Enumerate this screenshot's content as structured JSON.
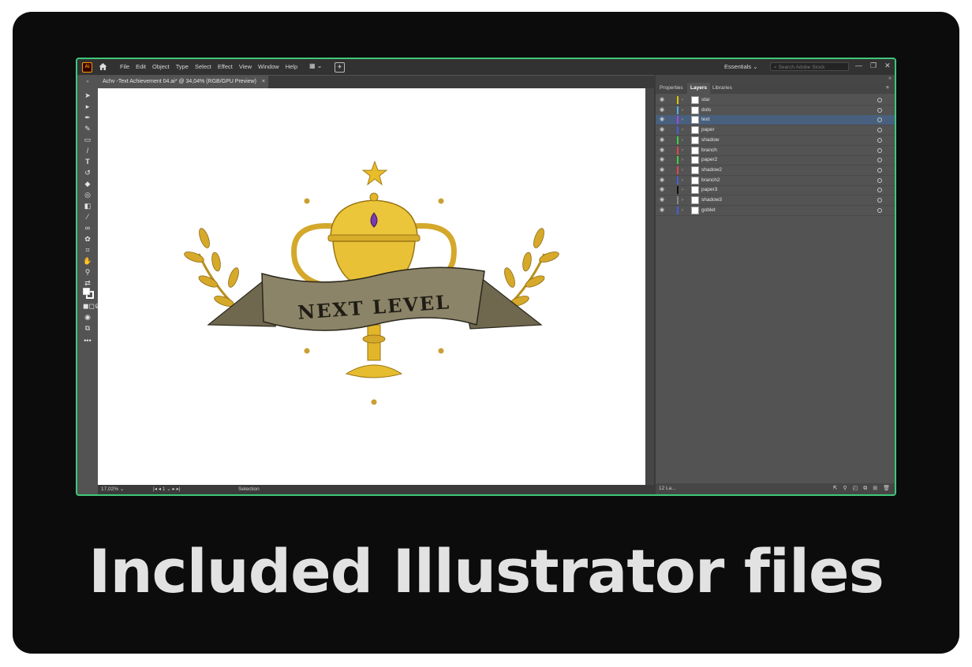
{
  "app": {
    "logo_text": "Ai",
    "menu": [
      "File",
      "Edit",
      "Object",
      "Type",
      "Select",
      "Effect",
      "View",
      "Window",
      "Help"
    ],
    "workspace": "Essentials",
    "search_placeholder": "Search Adobe Stock"
  },
  "document": {
    "tab_title": "Achv -Text Achievement 04.ai* @ 34,04% (RGB/GPU Preview)",
    "close": "×"
  },
  "artwork": {
    "banner_text": "NEXT LEVEL"
  },
  "status": {
    "zoom": "17,02%",
    "page": "1",
    "tool": "Selection"
  },
  "panel": {
    "tabs": [
      "Properties",
      "Layers",
      "Libraries"
    ],
    "active_tab": "Layers",
    "layers": [
      {
        "name": "star",
        "color": "#e0c400"
      },
      {
        "name": "dots",
        "color": "#4fb0e8"
      },
      {
        "name": "text",
        "color": "#a846e0"
      },
      {
        "name": "paper",
        "color": "#4060e0"
      },
      {
        "name": "shadow",
        "color": "#40d040"
      },
      {
        "name": "branch",
        "color": "#e04848"
      },
      {
        "name": "paper2",
        "color": "#40d040"
      },
      {
        "name": "shadow2",
        "color": "#e04848"
      },
      {
        "name": "branch2",
        "color": "#4060e0"
      },
      {
        "name": "paper3",
        "color": "#111111"
      },
      {
        "name": "shadow3",
        "color": "#888888"
      },
      {
        "name": "goblet",
        "color": "#4060e0"
      }
    ],
    "selected_layer": "text",
    "footer_count": "12 La..."
  },
  "caption": "Included Illustrator files",
  "colors": {
    "frame": "#0c0c0c",
    "window_border": "#3fc77a",
    "ui_panel": "#535353",
    "gold": "#e2b628",
    "ribbon": "#8c8468"
  }
}
